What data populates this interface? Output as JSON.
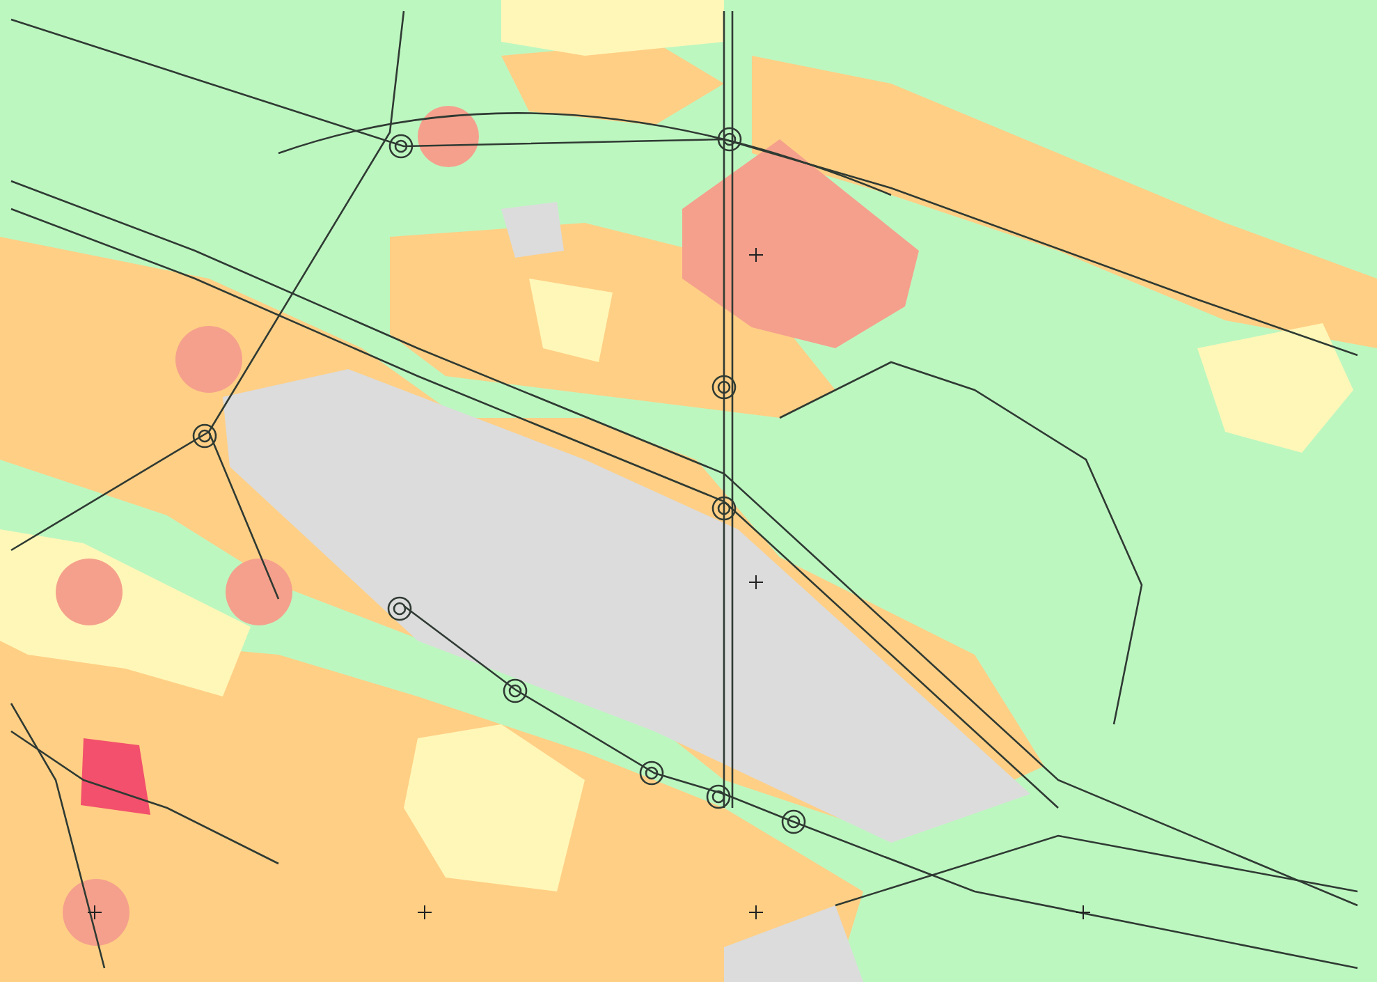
{
  "map": {
    "kind": "zone-map",
    "zones": [
      {
        "color": "#bdf7c0"
      },
      {
        "color": "#ffcf85"
      },
      {
        "color": "#fff7b8"
      },
      {
        "color": "#dcdcdc"
      },
      {
        "color": "#f5a08c"
      },
      {
        "color": "#f2506c"
      }
    ]
  }
}
